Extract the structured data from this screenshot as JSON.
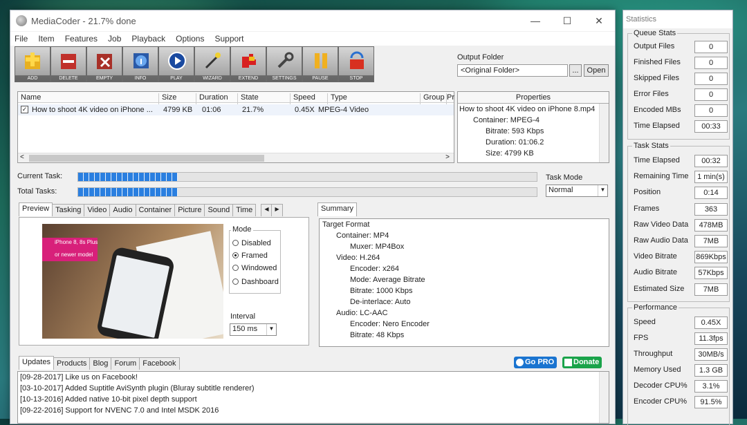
{
  "window": {
    "title": "MediaCoder - 21.7% done",
    "min_glyph": "—",
    "max_glyph": "☐",
    "close_glyph": "✕"
  },
  "menu": [
    "File",
    "Item",
    "Features",
    "Job",
    "Playback",
    "Options",
    "Support"
  ],
  "toolbar": [
    "ADD",
    "DELETE",
    "EMPTY",
    "INFO",
    "PLAY",
    "WIZARD",
    "EXTEND",
    "SETTINGS",
    "PAUSE",
    "STOP"
  ],
  "output": {
    "label": "Output Folder",
    "value": "<Original Folder>",
    "browse": "...",
    "open": "Open"
  },
  "list": {
    "headers": [
      "Name",
      "Size",
      "Duration",
      "State",
      "Speed",
      "Type",
      "Group",
      "Pr"
    ],
    "row": {
      "name": "How to shoot 4K video on iPhone ...",
      "size": "4799 KB",
      "duration": "01:06",
      "state": "21.7%",
      "speed": "0.45X",
      "type": "MPEG-4 Video"
    },
    "scroll_left": "<",
    "scroll_right": ">"
  },
  "properties": {
    "title": "Properties",
    "file": "How to shoot 4K video on iPhone 8.mp4",
    "container": "Container: MPEG-4",
    "bitrate": "Bitrate: 593 Kbps",
    "duration": "Duration: 01:06.2",
    "size": "Size: 4799 KB"
  },
  "progress": {
    "current_label": "Current Task:",
    "total_label": "Total Tasks:",
    "current": 0.217,
    "total": 0.217
  },
  "task_mode": {
    "label": "Task Mode",
    "value": "Normal"
  },
  "left_tabs": [
    "Preview",
    "Tasking",
    "Video",
    "Audio",
    "Container",
    "Picture",
    "Sound",
    "Time"
  ],
  "tab_nav": [
    "◀",
    "▶"
  ],
  "preview_overlay": [
    "iPhone 8, 8s Plus",
    "or newer model"
  ],
  "mode": {
    "label": "Mode",
    "options": [
      "Disabled",
      "Framed",
      "Windowed",
      "Dashboard"
    ],
    "selected": "Framed"
  },
  "interval": {
    "label": "Interval",
    "value": "150 ms"
  },
  "summary": {
    "tab": "Summary",
    "tree": [
      {
        "t": "Target Format",
        "d": 0
      },
      {
        "t": "Container: MP4",
        "d": 1
      },
      {
        "t": "Muxer: MP4Box",
        "d": 2
      },
      {
        "t": "Video: H.264",
        "d": 1
      },
      {
        "t": "Encoder: x264",
        "d": 2
      },
      {
        "t": "Mode: Average Bitrate",
        "d": 2
      },
      {
        "t": "Bitrate: 1000 Kbps",
        "d": 2
      },
      {
        "t": "De-interlace: Auto",
        "d": 2
      },
      {
        "t": "Audio: LC-AAC",
        "d": 1
      },
      {
        "t": "Encoder: Nero Encoder",
        "d": 2
      },
      {
        "t": "Bitrate: 48 Kbps",
        "d": 2
      }
    ]
  },
  "bottom_tabs": [
    "Updates",
    "Products",
    "Blog",
    "Forum",
    "Facebook"
  ],
  "gopro": "Go PRO",
  "donate": "Donate",
  "log": [
    "[09-28-2017] Like us on Facebook!",
    "[03-10-2017] Added Suptitle AviSynth plugin (Bluray subtitle renderer)",
    "[10-13-2016] Added native 10-bit pixel depth support",
    "[09-22-2016] Support for NVENC 7.0 and Intel MSDK 2016"
  ],
  "stats": {
    "title": "Statistics",
    "queue": {
      "title": "Queue Stats",
      "rows": [
        [
          "Output Files",
          "0"
        ],
        [
          "Finished Files",
          "0"
        ],
        [
          "Skipped Files",
          "0"
        ],
        [
          "Error Files",
          "0"
        ],
        [
          "Encoded MBs",
          "0"
        ],
        [
          "Time Elapsed",
          "00:33"
        ]
      ]
    },
    "task": {
      "title": "Task Stats",
      "rows": [
        [
          "Time Elapsed",
          "00:32"
        ],
        [
          "Remaining Time",
          "1 min(s)"
        ],
        [
          "Position",
          "0:14"
        ],
        [
          "Frames",
          "363"
        ],
        [
          "Raw Video Data",
          "478MB"
        ],
        [
          "Raw Audio Data",
          "7MB"
        ],
        [
          "Video Bitrate",
          "869Kbps"
        ],
        [
          "Audio Bitrate",
          "57Kbps"
        ],
        [
          "Estimated Size",
          "7MB"
        ]
      ]
    },
    "perf": {
      "title": "Performance",
      "rows": [
        [
          "Speed",
          "0.45X"
        ],
        [
          "FPS",
          "11.3fps"
        ],
        [
          "Throughput",
          "30MB/s"
        ],
        [
          "Memory Used",
          "1.3 GB"
        ],
        [
          "Decoder CPU%",
          "3.1%"
        ],
        [
          "Encoder CPU%",
          "91.5%"
        ]
      ]
    }
  },
  "colors": {
    "progress": "#2a7fe0",
    "gopro": "#1a74d0",
    "donate": "#1aa34a"
  }
}
